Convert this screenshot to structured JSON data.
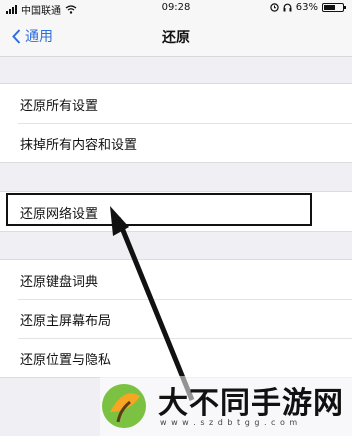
{
  "status_bar": {
    "carrier": "中国联通",
    "time": "09:28",
    "battery": "63%",
    "battery_level": 0.63,
    "icons": [
      "signal-icon",
      "wifi-icon",
      "alarm-icon",
      "headphones-icon",
      "battery-icon"
    ]
  },
  "nav": {
    "back_label": "通用",
    "title": "还原"
  },
  "group1": {
    "items": [
      {
        "label": "还原所有设置"
      },
      {
        "label": "抹掉所有内容和设置"
      }
    ]
  },
  "group2": {
    "items": [
      {
        "label": "还原网络设置"
      }
    ]
  },
  "group3": {
    "items": [
      {
        "label": "还原键盘词典"
      },
      {
        "label": "还原主屏幕布局"
      },
      {
        "label": "还原位置与隐私"
      }
    ]
  },
  "annotation": {
    "box_color": "#111111",
    "arrow_color": "#111111"
  },
  "watermark": {
    "text": "大不同手游网",
    "url": "w w w . s z d b t g g . c o m",
    "logo_colors": [
      "#7cc242",
      "#f6a623",
      "#5a3b1a"
    ]
  },
  "colors": {
    "accent": "#2f6fdc",
    "background": "#efeff4"
  }
}
